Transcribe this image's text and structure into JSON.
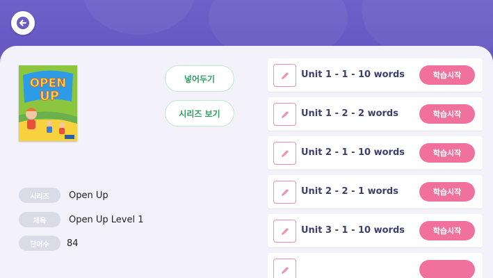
{
  "header": {
    "back_icon": "arrow-left-icon"
  },
  "book": {
    "cover_text_line1": "OPEN",
    "cover_text_line2": "UP"
  },
  "actions": {
    "put_away_label": "넣어두기",
    "view_series_label": "시리즈 보기"
  },
  "info": {
    "series_label": "시리즈",
    "series_value": "Open Up",
    "title_label": "제목",
    "title_value": "Open Up Level 1",
    "word_count_label": "단어수",
    "word_count_value": "84"
  },
  "units": [
    {
      "title": "Unit 1 - 1 - 10 words",
      "button": "학습시작"
    },
    {
      "title": "Unit 1 - 2 - 2 words",
      "button": "학습시작"
    },
    {
      "title": "Unit 2 - 1 - 10 words",
      "button": "학습시작"
    },
    {
      "title": "Unit 2 - 2 - 1 words",
      "button": "학습시작"
    },
    {
      "title": "Unit 3 - 1 - 10 words",
      "button": "학습시작"
    },
    {
      "title": "",
      "button": ""
    }
  ],
  "colors": {
    "header": "#6a5bc4",
    "accent_pink": "#f0719b",
    "accent_green": "#2f9d63",
    "panel_bg": "#f3f2fa"
  }
}
